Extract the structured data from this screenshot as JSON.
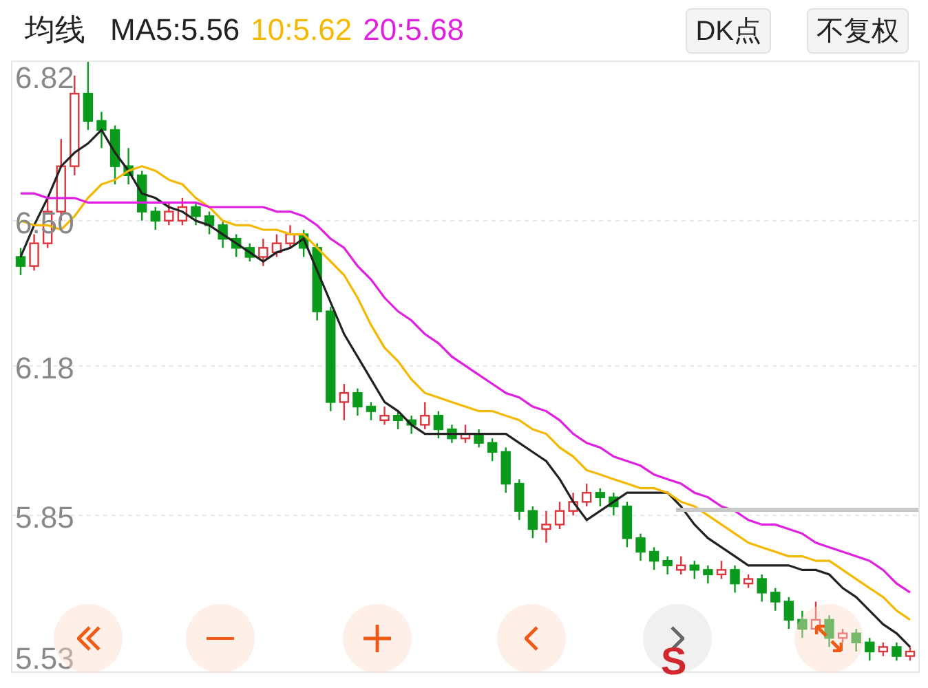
{
  "header": {
    "title": "均线",
    "indicators": [
      {
        "label": "MA5:5.56",
        "color": "#222222"
      },
      {
        "label": "10:5.62",
        "color": "#f5b800"
      },
      {
        "label": "20:5.68",
        "color": "#e020e0"
      }
    ],
    "buttons": [
      "DK点",
      "不复权"
    ]
  },
  "chart": {
    "chart_data": {
      "type": "candlestick",
      "grid": true,
      "ylim": [
        5.506,
        6.85
      ],
      "yticks": [
        {
          "value": 6.82,
          "label": "6.82"
        },
        {
          "value": 6.5,
          "label": "6.50"
        },
        {
          "value": 6.18,
          "label": "6.18"
        },
        {
          "value": 5.85,
          "label": "5.85"
        },
        {
          "value": 5.53,
          "label": "5.53"
        }
      ],
      "ohlc": [
        [
          6.42,
          6.44,
          6.38,
          6.4
        ],
        [
          6.4,
          6.47,
          6.39,
          6.45
        ],
        [
          6.45,
          6.55,
          6.44,
          6.52
        ],
        [
          6.52,
          6.68,
          6.5,
          6.62
        ],
        [
          6.62,
          6.82,
          6.6,
          6.78
        ],
        [
          6.78,
          6.85,
          6.7,
          6.72
        ],
        [
          6.72,
          6.74,
          6.66,
          6.7
        ],
        [
          6.7,
          6.71,
          6.58,
          6.62
        ],
        [
          6.62,
          6.66,
          6.58,
          6.6
        ],
        [
          6.6,
          6.61,
          6.5,
          6.52
        ],
        [
          6.52,
          6.53,
          6.48,
          6.5
        ],
        [
          6.5,
          6.54,
          6.49,
          6.52
        ],
        [
          6.5,
          6.55,
          6.49,
          6.53
        ],
        [
          6.53,
          6.54,
          6.49,
          6.51
        ],
        [
          6.51,
          6.52,
          6.47,
          6.49
        ],
        [
          6.49,
          6.5,
          6.44,
          6.46
        ],
        [
          6.46,
          6.47,
          6.42,
          6.44
        ],
        [
          6.44,
          6.45,
          6.41,
          6.42
        ],
        [
          6.42,
          6.46,
          6.4,
          6.44
        ],
        [
          6.43,
          6.47,
          6.42,
          6.45
        ],
        [
          6.45,
          6.49,
          6.44,
          6.47
        ],
        [
          6.47,
          6.48,
          6.42,
          6.44
        ],
        [
          6.44,
          6.45,
          6.28,
          6.3
        ],
        [
          6.3,
          6.31,
          6.08,
          6.1
        ],
        [
          6.1,
          6.14,
          6.06,
          6.12
        ],
        [
          6.12,
          6.13,
          6.07,
          6.09
        ],
        [
          6.09,
          6.1,
          6.06,
          6.08
        ],
        [
          6.06,
          6.09,
          6.05,
          6.07
        ],
        [
          6.07,
          6.08,
          6.04,
          6.06
        ],
        [
          6.06,
          6.07,
          6.03,
          6.05
        ],
        [
          6.05,
          6.1,
          6.04,
          6.07
        ],
        [
          6.07,
          6.08,
          6.02,
          6.04
        ],
        [
          6.04,
          6.05,
          6.01,
          6.02
        ],
        [
          6.02,
          6.05,
          6.01,
          6.03
        ],
        [
          6.03,
          6.04,
          6.0,
          6.01
        ],
        [
          6.01,
          6.02,
          5.97,
          5.99
        ],
        [
          5.99,
          6.0,
          5.9,
          5.92
        ],
        [
          5.92,
          5.93,
          5.84,
          5.86
        ],
        [
          5.86,
          5.87,
          5.8,
          5.82
        ],
        [
          5.82,
          5.86,
          5.79,
          5.83
        ],
        [
          5.83,
          5.88,
          5.82,
          5.86
        ],
        [
          5.86,
          5.9,
          5.85,
          5.88
        ],
        [
          5.88,
          5.92,
          5.87,
          5.9
        ],
        [
          5.9,
          5.91,
          5.87,
          5.89
        ],
        [
          5.89,
          5.9,
          5.85,
          5.87
        ],
        [
          5.87,
          5.88,
          5.78,
          5.8
        ],
        [
          5.8,
          5.81,
          5.75,
          5.77
        ],
        [
          5.77,
          5.78,
          5.73,
          5.75
        ],
        [
          5.75,
          5.76,
          5.72,
          5.74
        ],
        [
          5.73,
          5.76,
          5.72,
          5.74
        ],
        [
          5.74,
          5.75,
          5.71,
          5.73
        ],
        [
          5.73,
          5.74,
          5.7,
          5.72
        ],
        [
          5.72,
          5.75,
          5.71,
          5.73
        ],
        [
          5.73,
          5.74,
          5.68,
          5.7
        ],
        [
          5.7,
          5.72,
          5.69,
          5.71
        ],
        [
          5.71,
          5.72,
          5.66,
          5.68
        ],
        [
          5.68,
          5.69,
          5.64,
          5.66
        ],
        [
          5.66,
          5.67,
          5.6,
          5.62
        ],
        [
          5.62,
          5.64,
          5.58,
          5.6
        ],
        [
          5.6,
          5.66,
          5.59,
          5.62
        ],
        [
          5.62,
          5.63,
          5.56,
          5.58
        ],
        [
          5.58,
          5.6,
          5.57,
          5.59
        ],
        [
          5.59,
          5.6,
          5.55,
          5.57
        ],
        [
          5.57,
          5.58,
          5.53,
          5.55
        ],
        [
          5.55,
          5.57,
          5.54,
          5.56
        ],
        [
          5.56,
          5.57,
          5.53,
          5.54
        ],
        [
          5.54,
          5.56,
          5.53,
          5.55
        ]
      ],
      "series": [
        {
          "type": "line",
          "color": "#222222",
          "values": [
            6.42,
            6.49,
            6.55,
            6.62,
            6.65,
            6.67,
            6.7,
            6.65,
            6.61,
            6.56,
            6.55,
            6.53,
            6.52,
            6.5,
            6.49,
            6.47,
            6.45,
            6.43,
            6.41,
            6.43,
            6.44,
            6.46,
            6.39,
            6.32,
            6.25,
            6.2,
            6.15,
            6.1,
            6.08,
            6.05,
            6.03,
            6.03,
            6.03,
            6.03,
            6.03,
            6.03,
            6.03,
            6.01,
            5.99,
            5.97,
            5.93,
            5.88,
            5.84,
            5.86,
            5.88,
            5.9,
            5.9,
            5.9,
            5.9,
            5.87,
            5.83,
            5.8,
            5.78,
            5.76,
            5.74,
            5.74,
            5.74,
            5.74,
            5.73,
            5.73,
            5.72,
            5.69,
            5.67,
            5.64,
            5.61,
            5.59,
            5.56
          ]
        },
        {
          "type": "line",
          "color": "#f5b800",
          "values": [
            6.5,
            6.49,
            6.49,
            6.48,
            6.51,
            6.55,
            6.58,
            6.59,
            6.61,
            6.62,
            6.61,
            6.59,
            6.58,
            6.55,
            6.53,
            6.5,
            6.49,
            6.49,
            6.48,
            6.48,
            6.47,
            6.47,
            6.44,
            6.41,
            6.38,
            6.33,
            6.27,
            6.22,
            6.19,
            6.15,
            6.12,
            6.11,
            6.1,
            6.09,
            6.08,
            6.08,
            6.07,
            6.06,
            6.04,
            6.03,
            6.0,
            5.98,
            5.95,
            5.94,
            5.93,
            5.92,
            5.91,
            5.91,
            5.9,
            5.88,
            5.87,
            5.85,
            5.83,
            5.81,
            5.79,
            5.78,
            5.77,
            5.76,
            5.76,
            5.75,
            5.75,
            5.73,
            5.71,
            5.69,
            5.67,
            5.64,
            5.62
          ]
        },
        {
          "type": "line",
          "color": "#e020e0",
          "values": [
            6.56,
            6.56,
            6.55,
            6.55,
            6.55,
            6.54,
            6.54,
            6.54,
            6.54,
            6.54,
            6.54,
            6.54,
            6.54,
            6.54,
            6.53,
            6.53,
            6.53,
            6.53,
            6.53,
            6.52,
            6.52,
            6.51,
            6.49,
            6.46,
            6.44,
            6.4,
            6.37,
            6.33,
            6.3,
            6.28,
            6.25,
            6.23,
            6.2,
            6.18,
            6.16,
            6.14,
            6.12,
            6.11,
            6.09,
            6.08,
            6.06,
            6.03,
            6.01,
            6.0,
            5.98,
            5.97,
            5.96,
            5.94,
            5.93,
            5.92,
            5.9,
            5.89,
            5.87,
            5.86,
            5.84,
            5.83,
            5.83,
            5.82,
            5.81,
            5.79,
            5.78,
            5.77,
            5.76,
            5.75,
            5.73,
            5.7,
            5.68
          ]
        }
      ]
    },
    "markers": [
      {
        "label": "S"
      }
    ],
    "controls": [
      {
        "kind": "first",
        "disabled": false
      },
      {
        "kind": "minus",
        "disabled": false
      },
      {
        "kind": "plus",
        "disabled": false
      },
      {
        "kind": "prev",
        "disabled": false
      },
      {
        "kind": "next",
        "disabled": true
      },
      {
        "kind": "expand",
        "disabled": false
      }
    ]
  }
}
